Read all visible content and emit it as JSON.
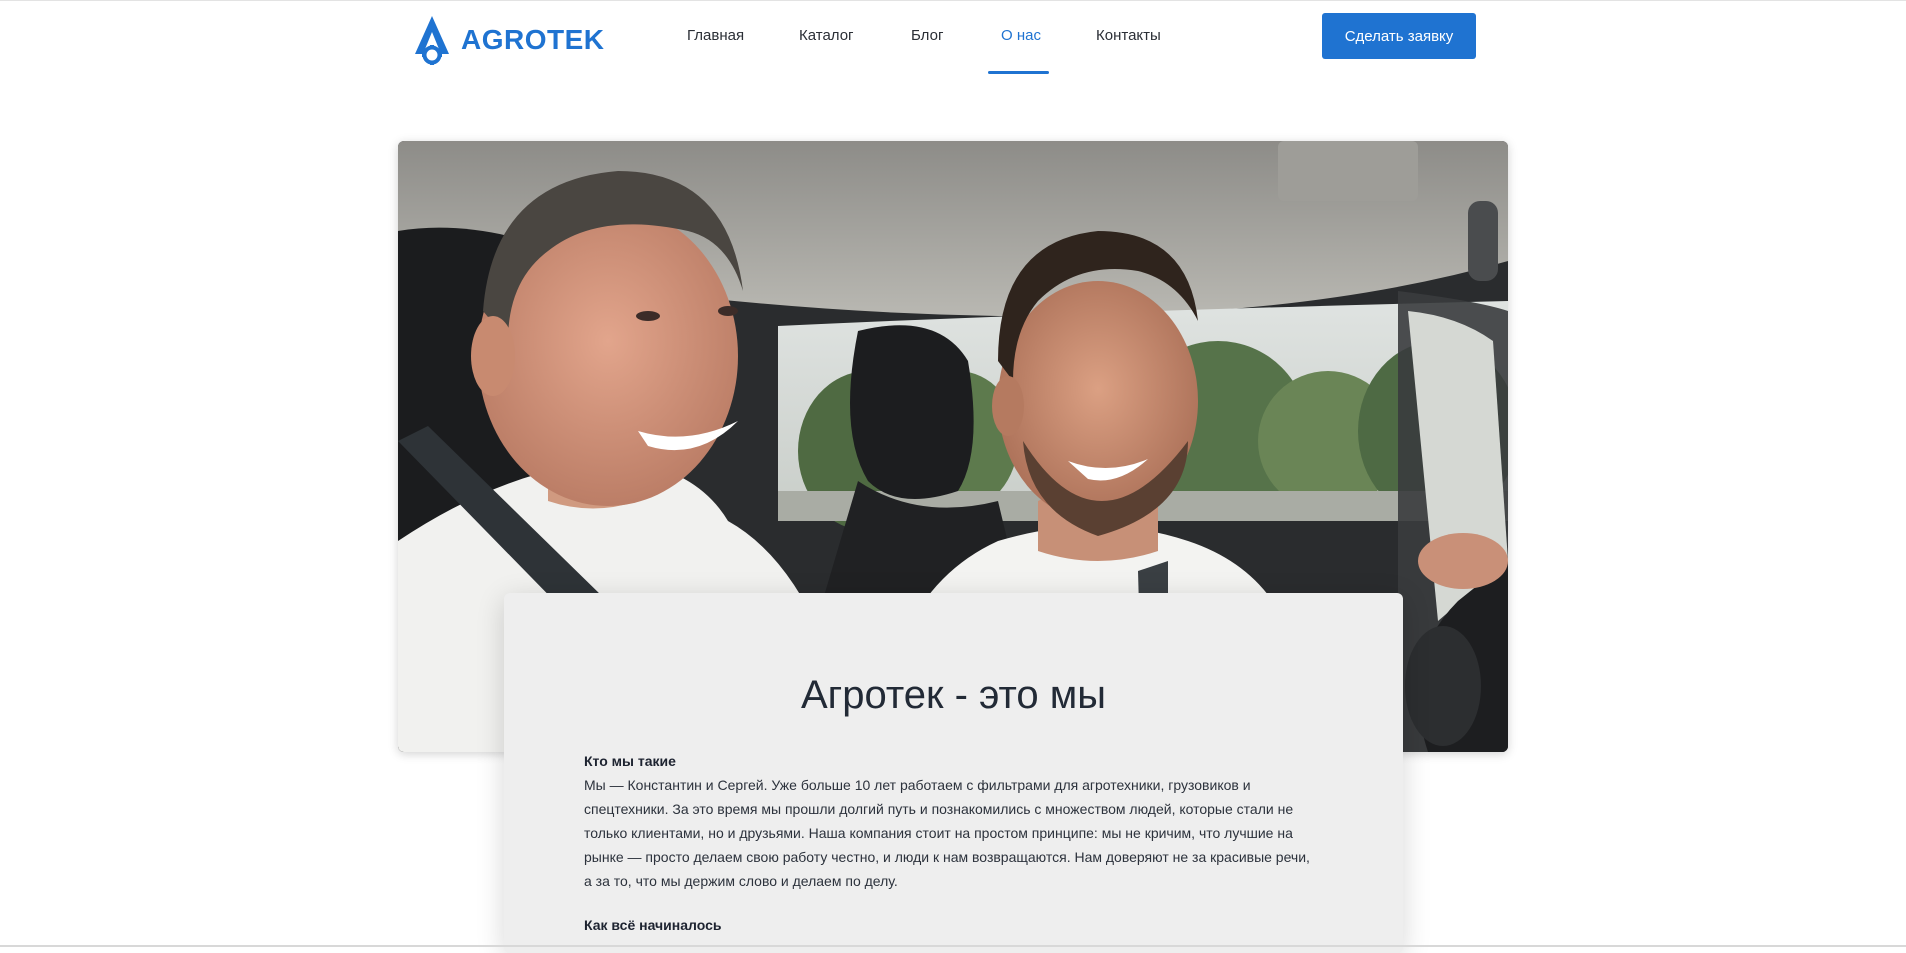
{
  "brand": {
    "name": "AGROTEK",
    "color": "#1f73d1"
  },
  "nav": {
    "items": [
      {
        "label": "Главная",
        "active": false
      },
      {
        "label": "Каталог",
        "active": false
      },
      {
        "label": "Блог",
        "active": false
      },
      {
        "label": "О нас",
        "active": true
      },
      {
        "label": "Контакты",
        "active": false
      }
    ],
    "cta_label": "Сделать заявку"
  },
  "hero": {
    "image": "photo-two-men-in-car"
  },
  "about": {
    "title": "Агротек - это мы",
    "section1": {
      "heading": "Кто мы такие",
      "lines": [
        "Мы — Константин и Сергей. Уже больше 10 лет работаем с фильтрами для агротехники, грузовиков и",
        "спецтехники. За это время мы прошли долгий путь и познакомились с множеством людей, которые стали не",
        "только клиентами, но и друзьями. Наша компания стоит на простом принципе: мы не кричим, что лучшие на",
        "рынке — просто делаем свою работу честно, и люди к нам возвращаются. Нам доверяют не за красивые речи,",
        "а за то, что мы держим слово и делаем по делу."
      ]
    },
    "section2": {
      "heading": "Как всё начиналось"
    }
  }
}
